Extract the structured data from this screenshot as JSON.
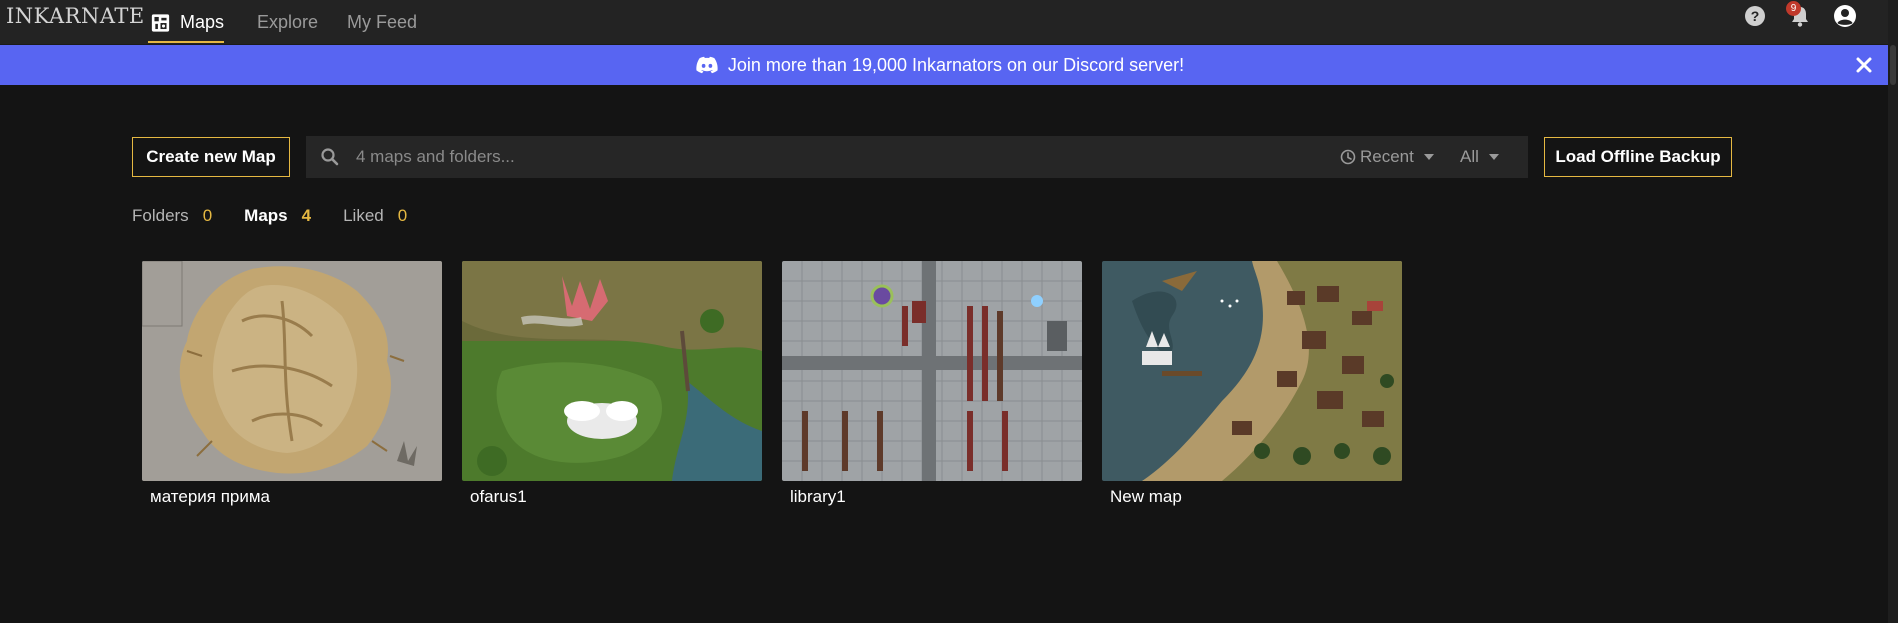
{
  "brand": {
    "logo_text": "INKARNATE"
  },
  "nav": {
    "items": [
      {
        "label": "Maps",
        "active": true
      },
      {
        "label": "Explore",
        "active": false
      },
      {
        "label": "My Feed",
        "active": false
      }
    ],
    "notification_count": "9"
  },
  "banner": {
    "text": "Join more than 19,000 Inkarnators on our Discord server!",
    "color": "#5865f2"
  },
  "toolbar": {
    "create_label": "Create new Map",
    "search_placeholder": "4 maps and folders...",
    "sort_label": "Recent",
    "filter_label": "All",
    "offline_label": "Load Offline Backup"
  },
  "filters": [
    {
      "label": "Folders",
      "count": "0",
      "active": false
    },
    {
      "label": "Maps",
      "count": "4",
      "active": true
    },
    {
      "label": "Liked",
      "count": "0",
      "active": false
    }
  ],
  "maps": [
    {
      "title": "материя прима"
    },
    {
      "title": "ofarus1"
    },
    {
      "title": "library1"
    },
    {
      "title": "New map"
    }
  ],
  "colors": {
    "accent": "#e5b842",
    "background": "#141414",
    "topbar": "#232323"
  }
}
